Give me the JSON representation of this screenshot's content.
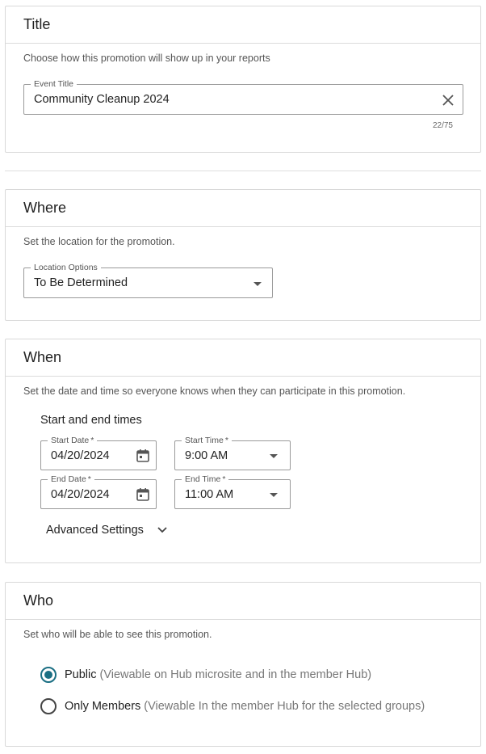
{
  "title_section": {
    "heading": "Title",
    "description": "Choose how this promotion will show up in your reports",
    "field_label": "Event Title",
    "value": "Community Cleanup 2024",
    "counter": "22/75"
  },
  "where_section": {
    "heading": "Where",
    "description": "Set the location for the promotion.",
    "field_label": "Location Options",
    "value": "To Be Determined"
  },
  "when_section": {
    "heading": "When",
    "description": "Set the date and time so everyone knows when they can participate in this promotion.",
    "subheading": "Start and end times",
    "start_date": {
      "label": "Start Date",
      "required_mark": "*",
      "value": "04/20/2024"
    },
    "start_time": {
      "label": "Start Time",
      "required_mark": "*",
      "value": "9:00 AM"
    },
    "end_date": {
      "label": "End Date",
      "required_mark": "*",
      "value": "04/20/2024"
    },
    "end_time": {
      "label": "End Time",
      "required_mark": "*",
      "value": "11:00 AM"
    },
    "advanced_label": "Advanced Settings"
  },
  "who_section": {
    "heading": "Who",
    "description": "Set who will be able to see this promotion.",
    "options": [
      {
        "label": "Public",
        "help": "(Viewable on Hub microsite and in the member Hub)",
        "selected": true
      },
      {
        "label": "Only Members",
        "help": "(Viewable In the member Hub for the selected groups)",
        "selected": false
      }
    ]
  },
  "colors": {
    "accent": "#1b6f83",
    "border": "#d9d9d9"
  }
}
